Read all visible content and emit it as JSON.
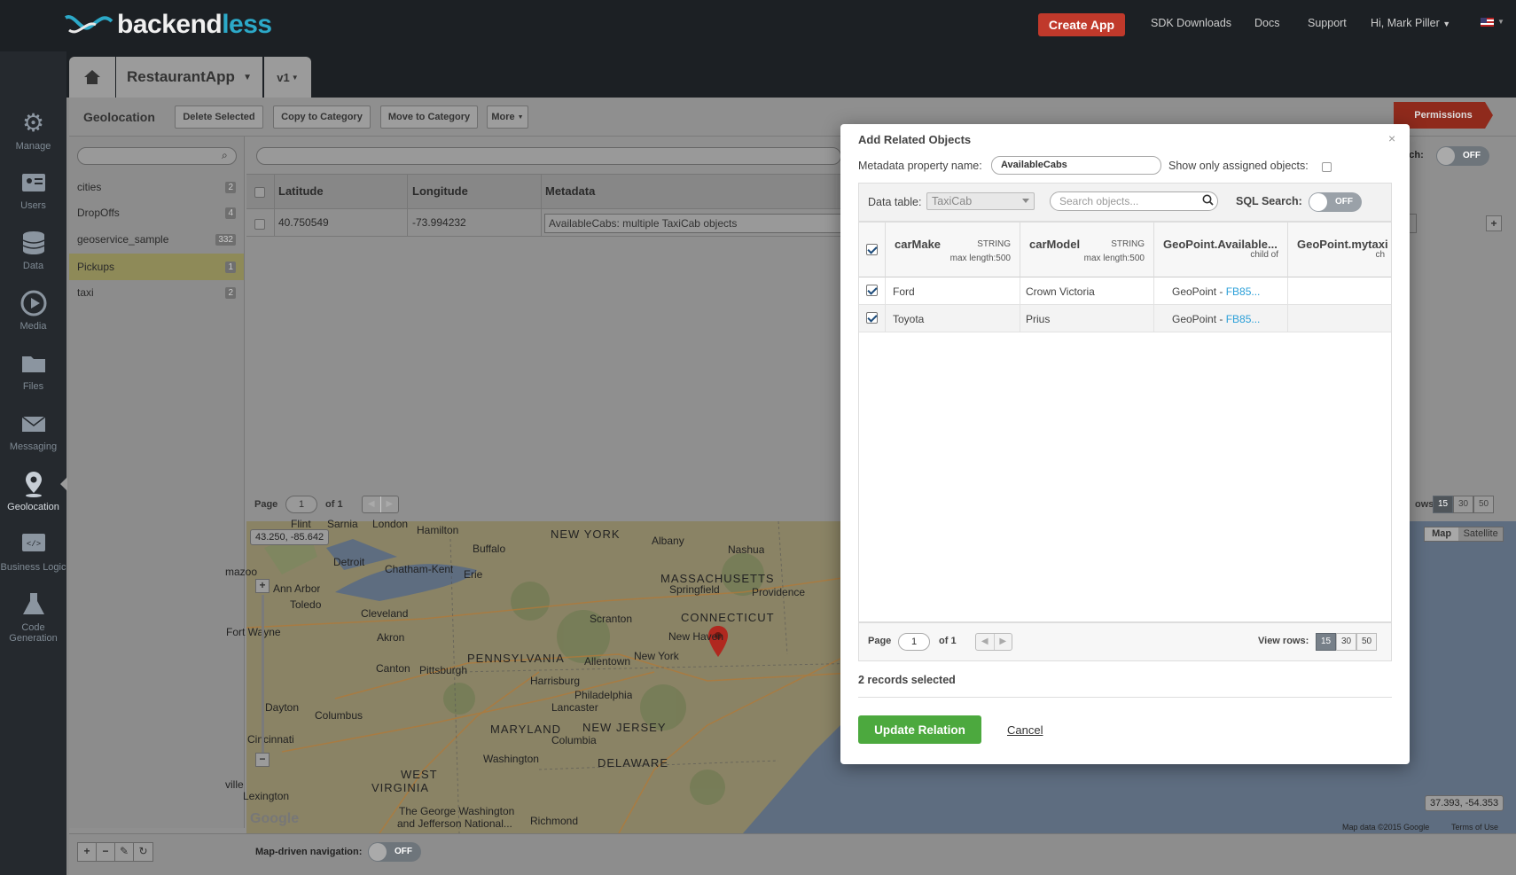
{
  "brand": {
    "logo_prefix": "backend",
    "logo_suffix": "less"
  },
  "topnav": {
    "create_app": "Create App",
    "sdk": "SDK Downloads",
    "docs": "Docs",
    "support": "Support",
    "user": "Hi, Mark Piller"
  },
  "leftnav": [
    {
      "label": "Manage",
      "icon": "gear-icon"
    },
    {
      "label": "Users",
      "icon": "id-card-icon"
    },
    {
      "label": "Data",
      "icon": "database-icon"
    },
    {
      "label": "Media",
      "icon": "play-icon"
    },
    {
      "label": "Files",
      "icon": "folder-icon"
    },
    {
      "label": "Messaging",
      "icon": "envelope-icon"
    },
    {
      "label": "Geolocation",
      "icon": "pin-icon",
      "active": true
    },
    {
      "label": "Business Logic",
      "icon": "code-icon"
    },
    {
      "label": "Code Generation",
      "icon": "flask-icon"
    }
  ],
  "apptabs": {
    "app": "RestaurantApp",
    "version": "v1"
  },
  "toolbar": {
    "title": "Geolocation",
    "delete": "Delete Selected",
    "copy": "Copy to Category",
    "move": "Move to Category",
    "more": "More",
    "permissions": "Permissions"
  },
  "categories": [
    {
      "name": "cities",
      "count": "2"
    },
    {
      "name": "DropOffs",
      "count": "4"
    },
    {
      "name": "geoservice_sample",
      "count": "332"
    },
    {
      "name": "Pickups",
      "count": "1",
      "selected": true
    },
    {
      "name": "taxi",
      "count": "2"
    }
  ],
  "grid": {
    "headers": [
      "Latitude",
      "Longitude",
      "Metadata"
    ],
    "rows": [
      {
        "lat": "40.750549",
        "lng": "-73.994232",
        "meta": "AvailableCabs: multiple TaxiCab objects"
      }
    ],
    "search_label": "rch:",
    "search_toggle": "OFF",
    "page_label": "Page",
    "page_value": "1",
    "page_of": "of 1",
    "rows_label": "ows:",
    "rows_options": [
      "15",
      "30",
      "50"
    ]
  },
  "map": {
    "coord_top": "43.250, -85.642",
    "coord_bottom": "37.393, -54.353",
    "type_map": "Map",
    "type_satellite": "Satellite",
    "attribution": "Map data ©2015 Google",
    "terms": "Terms of Use",
    "google": "Google",
    "cities": [
      {
        "name": "Hamilton"
      },
      {
        "name": "London"
      },
      {
        "name": "Sarnia"
      },
      {
        "name": "Flint"
      },
      {
        "name": "NEW YORK"
      },
      {
        "name": "Albany"
      },
      {
        "name": "Buffalo"
      },
      {
        "name": "Detroit"
      },
      {
        "name": "Chatham-Kent"
      },
      {
        "name": "Erie"
      },
      {
        "name": "MASSACHUSETTS"
      },
      {
        "name": "Springfield"
      },
      {
        "name": "Providence"
      },
      {
        "name": "Nashua"
      },
      {
        "name": "Ann Arbor"
      },
      {
        "name": "Toledo"
      },
      {
        "name": "Cleveland"
      },
      {
        "name": "Scranton"
      },
      {
        "name": "CONNECTICUT"
      },
      {
        "name": "New Haven"
      },
      {
        "name": "Fort Wayne"
      },
      {
        "name": "Akron"
      },
      {
        "name": "PENNSYLVANIA"
      },
      {
        "name": "Allentown"
      },
      {
        "name": "New York"
      },
      {
        "name": "Canton"
      },
      {
        "name": "Pittsburgh"
      },
      {
        "name": "Harrisburg"
      },
      {
        "name": "Philadelphia"
      },
      {
        "name": "Dayton"
      },
      {
        "name": "Columbus"
      },
      {
        "name": "Lancaster"
      },
      {
        "name": "MARYLAND"
      },
      {
        "name": "NEW JERSEY"
      },
      {
        "name": "Cincinnati"
      },
      {
        "name": "Columbia"
      },
      {
        "name": "Washington"
      },
      {
        "name": "DELAWARE"
      },
      {
        "name": "WEST"
      },
      {
        "name": "VIRGINIA"
      },
      {
        "name": "Lexington"
      },
      {
        "name": "Richmond"
      },
      {
        "name": "The George Washington"
      },
      {
        "name": "and Jefferson National..."
      },
      {
        "name": "mazoo"
      },
      {
        "name": "ville"
      }
    ]
  },
  "bottombar": {
    "nav_label": "Map-driven navigation:",
    "nav_toggle": "OFF"
  },
  "modal": {
    "title": "Add Related Objects",
    "prop_label": "Metadata property name:",
    "prop_value": "AvailableCabs",
    "show_assigned": "Show only assigned objects:",
    "data_table_label": "Data table:",
    "data_table_value": "TaxiCab",
    "search_placeholder": "Search objects...",
    "sql_label": "SQL Search:",
    "sql_toggle": "OFF",
    "columns": [
      {
        "name": "carMake",
        "type": "STRING",
        "sub": "max length:500"
      },
      {
        "name": "carModel",
        "type": "STRING",
        "sub": "max length:500"
      },
      {
        "name": "GeoPoint.Available...",
        "type": "",
        "sub": "child of"
      },
      {
        "name": "GeoPoint.mytaxi",
        "type": "",
        "sub": "ch"
      }
    ],
    "rows": [
      {
        "make": "Ford",
        "model": "Crown Victoria",
        "geo_prefix": "GeoPoint - ",
        "geo_link": "FB85..."
      },
      {
        "make": "Toyota",
        "model": "Prius",
        "geo_prefix": "GeoPoint - ",
        "geo_link": "FB85..."
      }
    ],
    "page_label": "Page",
    "page_value": "1",
    "page_of": "of 1",
    "view_rows_label": "View rows:",
    "view_rows": [
      "15",
      "30",
      "50"
    ],
    "selected_text": "2 records selected",
    "update": "Update Relation",
    "cancel": "Cancel"
  }
}
